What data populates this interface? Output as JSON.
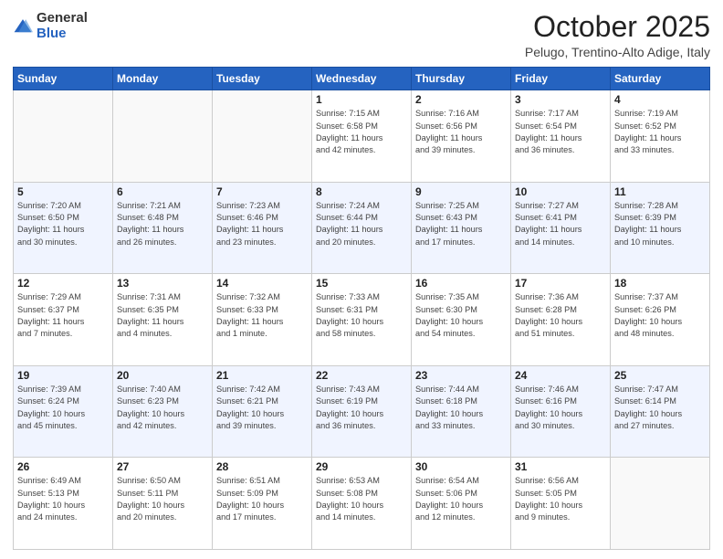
{
  "header": {
    "logo": {
      "general": "General",
      "blue": "Blue"
    },
    "title": "October 2025",
    "location": "Pelugo, Trentino-Alto Adige, Italy"
  },
  "days_of_week": [
    "Sunday",
    "Monday",
    "Tuesday",
    "Wednesday",
    "Thursday",
    "Friday",
    "Saturday"
  ],
  "weeks": [
    [
      {
        "day": "",
        "info": ""
      },
      {
        "day": "",
        "info": ""
      },
      {
        "day": "",
        "info": ""
      },
      {
        "day": "1",
        "info": "Sunrise: 7:15 AM\nSunset: 6:58 PM\nDaylight: 11 hours\nand 42 minutes."
      },
      {
        "day": "2",
        "info": "Sunrise: 7:16 AM\nSunset: 6:56 PM\nDaylight: 11 hours\nand 39 minutes."
      },
      {
        "day": "3",
        "info": "Sunrise: 7:17 AM\nSunset: 6:54 PM\nDaylight: 11 hours\nand 36 minutes."
      },
      {
        "day": "4",
        "info": "Sunrise: 7:19 AM\nSunset: 6:52 PM\nDaylight: 11 hours\nand 33 minutes."
      }
    ],
    [
      {
        "day": "5",
        "info": "Sunrise: 7:20 AM\nSunset: 6:50 PM\nDaylight: 11 hours\nand 30 minutes."
      },
      {
        "day": "6",
        "info": "Sunrise: 7:21 AM\nSunset: 6:48 PM\nDaylight: 11 hours\nand 26 minutes."
      },
      {
        "day": "7",
        "info": "Sunrise: 7:23 AM\nSunset: 6:46 PM\nDaylight: 11 hours\nand 23 minutes."
      },
      {
        "day": "8",
        "info": "Sunrise: 7:24 AM\nSunset: 6:44 PM\nDaylight: 11 hours\nand 20 minutes."
      },
      {
        "day": "9",
        "info": "Sunrise: 7:25 AM\nSunset: 6:43 PM\nDaylight: 11 hours\nand 17 minutes."
      },
      {
        "day": "10",
        "info": "Sunrise: 7:27 AM\nSunset: 6:41 PM\nDaylight: 11 hours\nand 14 minutes."
      },
      {
        "day": "11",
        "info": "Sunrise: 7:28 AM\nSunset: 6:39 PM\nDaylight: 11 hours\nand 10 minutes."
      }
    ],
    [
      {
        "day": "12",
        "info": "Sunrise: 7:29 AM\nSunset: 6:37 PM\nDaylight: 11 hours\nand 7 minutes."
      },
      {
        "day": "13",
        "info": "Sunrise: 7:31 AM\nSunset: 6:35 PM\nDaylight: 11 hours\nand 4 minutes."
      },
      {
        "day": "14",
        "info": "Sunrise: 7:32 AM\nSunset: 6:33 PM\nDaylight: 11 hours\nand 1 minute."
      },
      {
        "day": "15",
        "info": "Sunrise: 7:33 AM\nSunset: 6:31 PM\nDaylight: 10 hours\nand 58 minutes."
      },
      {
        "day": "16",
        "info": "Sunrise: 7:35 AM\nSunset: 6:30 PM\nDaylight: 10 hours\nand 54 minutes."
      },
      {
        "day": "17",
        "info": "Sunrise: 7:36 AM\nSunset: 6:28 PM\nDaylight: 10 hours\nand 51 minutes."
      },
      {
        "day": "18",
        "info": "Sunrise: 7:37 AM\nSunset: 6:26 PM\nDaylight: 10 hours\nand 48 minutes."
      }
    ],
    [
      {
        "day": "19",
        "info": "Sunrise: 7:39 AM\nSunset: 6:24 PM\nDaylight: 10 hours\nand 45 minutes."
      },
      {
        "day": "20",
        "info": "Sunrise: 7:40 AM\nSunset: 6:23 PM\nDaylight: 10 hours\nand 42 minutes."
      },
      {
        "day": "21",
        "info": "Sunrise: 7:42 AM\nSunset: 6:21 PM\nDaylight: 10 hours\nand 39 minutes."
      },
      {
        "day": "22",
        "info": "Sunrise: 7:43 AM\nSunset: 6:19 PM\nDaylight: 10 hours\nand 36 minutes."
      },
      {
        "day": "23",
        "info": "Sunrise: 7:44 AM\nSunset: 6:18 PM\nDaylight: 10 hours\nand 33 minutes."
      },
      {
        "day": "24",
        "info": "Sunrise: 7:46 AM\nSunset: 6:16 PM\nDaylight: 10 hours\nand 30 minutes."
      },
      {
        "day": "25",
        "info": "Sunrise: 7:47 AM\nSunset: 6:14 PM\nDaylight: 10 hours\nand 27 minutes."
      }
    ],
    [
      {
        "day": "26",
        "info": "Sunrise: 6:49 AM\nSunset: 5:13 PM\nDaylight: 10 hours\nand 24 minutes."
      },
      {
        "day": "27",
        "info": "Sunrise: 6:50 AM\nSunset: 5:11 PM\nDaylight: 10 hours\nand 20 minutes."
      },
      {
        "day": "28",
        "info": "Sunrise: 6:51 AM\nSunset: 5:09 PM\nDaylight: 10 hours\nand 17 minutes."
      },
      {
        "day": "29",
        "info": "Sunrise: 6:53 AM\nSunset: 5:08 PM\nDaylight: 10 hours\nand 14 minutes."
      },
      {
        "day": "30",
        "info": "Sunrise: 6:54 AM\nSunset: 5:06 PM\nDaylight: 10 hours\nand 12 minutes."
      },
      {
        "day": "31",
        "info": "Sunrise: 6:56 AM\nSunset: 5:05 PM\nDaylight: 10 hours\nand 9 minutes."
      },
      {
        "day": "",
        "info": ""
      }
    ]
  ]
}
